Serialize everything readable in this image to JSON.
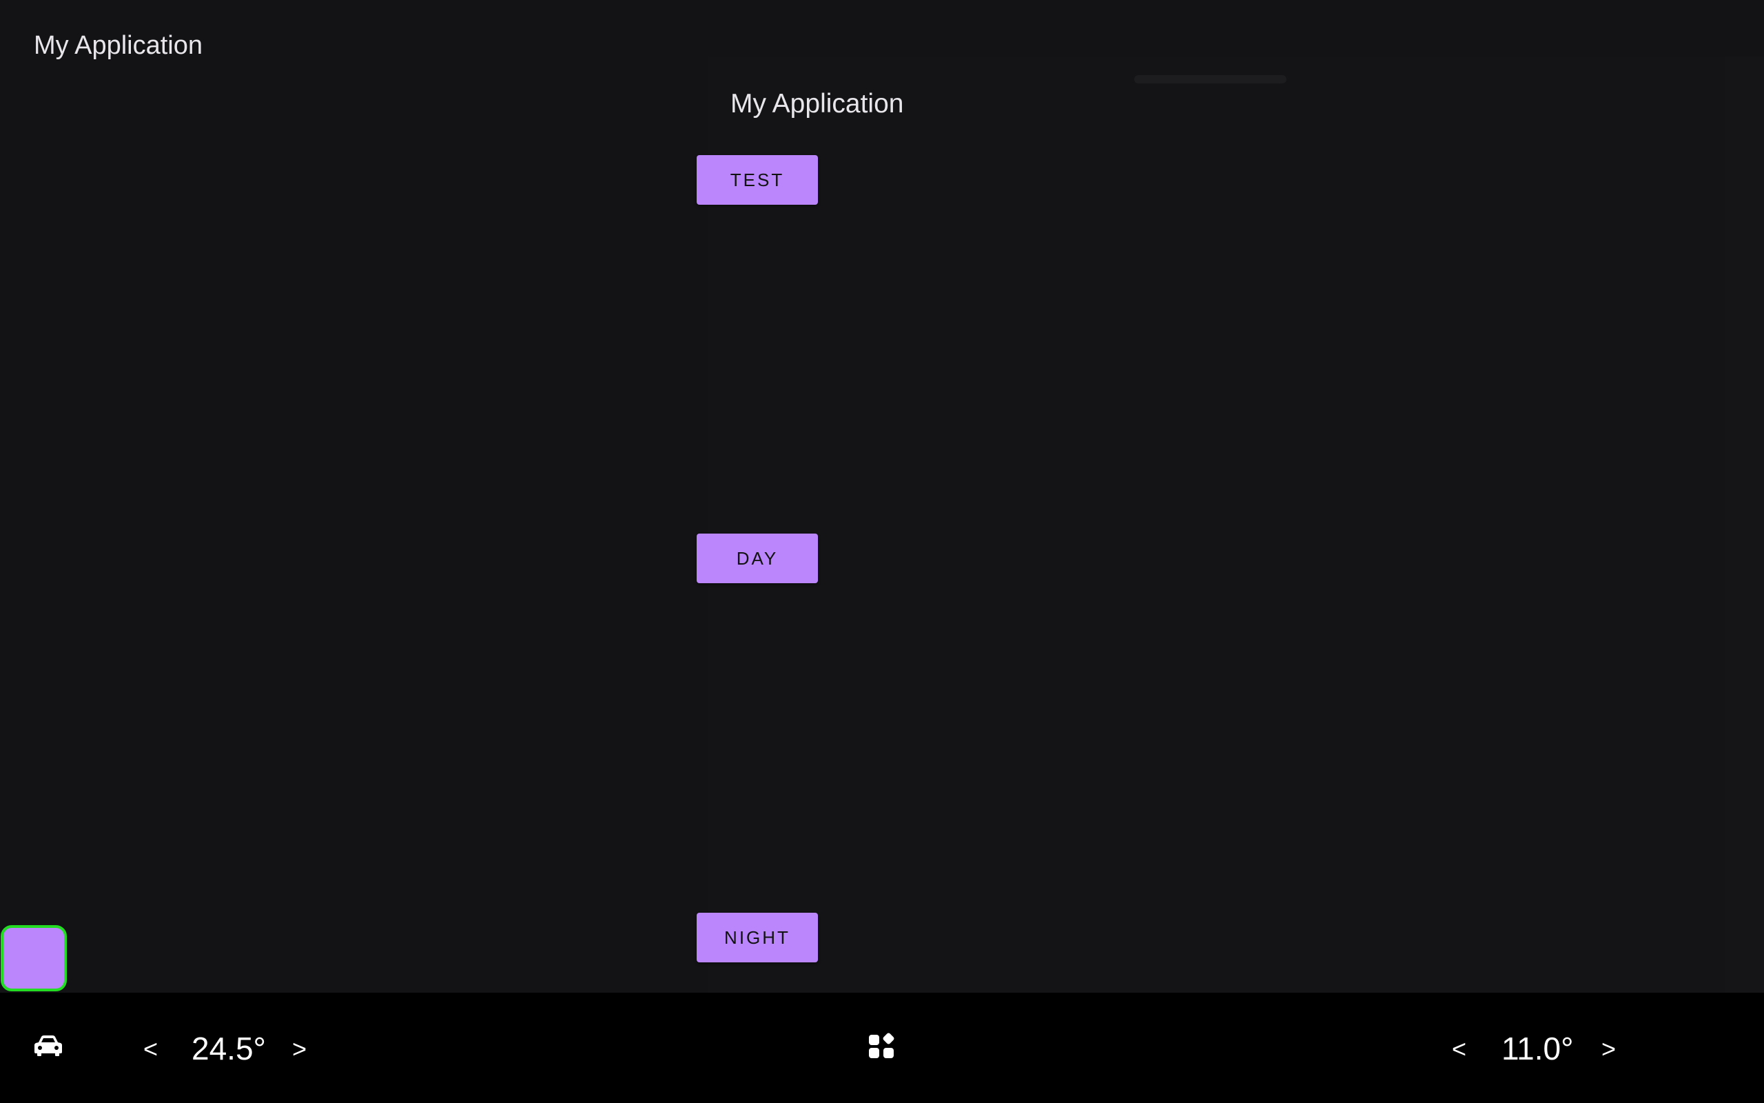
{
  "app": {
    "title": "My Application"
  },
  "panel": {
    "title": "My Application",
    "buttons": {
      "test": "TEST",
      "day": "DAY",
      "night": "NIGHT"
    }
  },
  "system_bar": {
    "left_temp": {
      "decrease": "<",
      "value": "24.5°",
      "increase": ">"
    },
    "right_temp": {
      "decrease": "<",
      "value": "11.0°",
      "increase": ">"
    },
    "icons": {
      "car": "car-icon",
      "apps": "apps-grid-icon"
    }
  },
  "colors": {
    "background": "#131315",
    "accent": "#bb86fc",
    "focus_border": "#22dd22",
    "system_bar": "#000000",
    "text": "#e8e6ea"
  }
}
